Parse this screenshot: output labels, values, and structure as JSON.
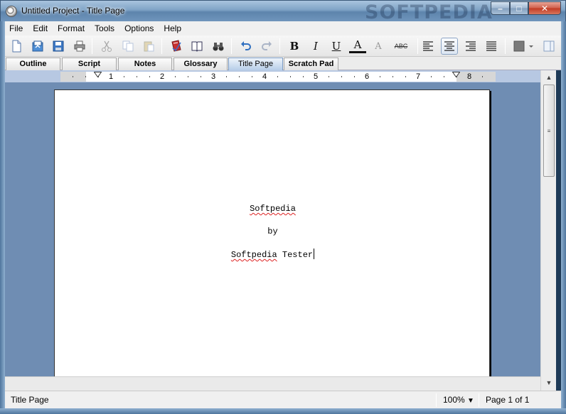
{
  "window": {
    "title": "Untitled Project - Title Page",
    "watermark": "SOFTPEDIA",
    "minimize_glyph": "–",
    "maximize_glyph": "□",
    "close_glyph": "✕"
  },
  "menu": [
    "File",
    "Edit",
    "Format",
    "Tools",
    "Options",
    "Help"
  ],
  "toolbar": {
    "icons": [
      "new-file-icon",
      "open-file-icon",
      "save-icon",
      "print-icon",
      "cut-icon",
      "copy-icon",
      "paste-icon",
      "spellcheck-book-icon",
      "dictionary-book-icon",
      "binoculars-find-icon",
      "undo-icon",
      "redo-icon",
      "bold-icon",
      "italic-icon",
      "underline-icon",
      "font-color-icon",
      "clear-format-icon",
      "strikethrough-icon",
      "align-left-icon",
      "align-center-icon",
      "align-right-icon",
      "justify-icon",
      "color-square-icon",
      "panel-icon"
    ],
    "bold": "B",
    "italic": "I",
    "underline": "U",
    "font_color": "A",
    "clear_format": "A",
    "strikethrough": "ABC",
    "active_alignment": "center",
    "accent_color": "#2f6fc0"
  },
  "tabs": [
    {
      "label": "Outline",
      "active": false
    },
    {
      "label": "Script",
      "active": false
    },
    {
      "label": "Notes",
      "active": false
    },
    {
      "label": "Glossary",
      "active": false
    },
    {
      "label": "Title Page",
      "active": true
    },
    {
      "label": "Scratch Pad",
      "active": false
    }
  ],
  "ruler": {
    "numbers": [
      "1",
      "2",
      "3",
      "4",
      "5",
      "6",
      "7",
      "8"
    ]
  },
  "document": {
    "lines": [
      "Softpedia",
      "by",
      "Softpedia Tester"
    ]
  },
  "scrollbar": {
    "up": "▲",
    "down": "▼",
    "grip": "≡"
  },
  "status": {
    "mode": "Title Page",
    "zoom": "100%",
    "zoom_arrow": "▼",
    "page": "Page 1 of 1"
  }
}
